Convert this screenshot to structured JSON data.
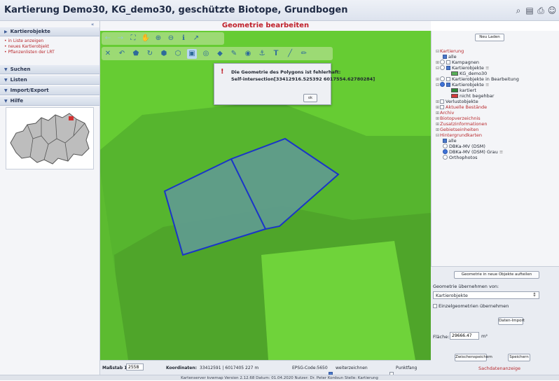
{
  "app": {
    "title": "Kartierung Demo30, KG_demo30, geschützte Biotope, Grundbogen"
  },
  "title_icons": [
    "search-icon",
    "book-icon",
    "print-icon",
    "user-icon"
  ],
  "sidebar": {
    "sections": [
      {
        "label": "Kartierobjekte"
      },
      {
        "label": "Suchen"
      },
      {
        "label": "Listen"
      },
      {
        "label": "Import/Export"
      },
      {
        "label": "Hilfe"
      }
    ],
    "links": [
      {
        "label": "• in Liste anzeigen"
      },
      {
        "label": "• neues Kartierobjekt"
      },
      {
        "label": "• Pflanzenlisten der LRT"
      }
    ],
    "collapse_icon": "double-chevron-left-icon"
  },
  "map": {
    "heading": "Geometrie bearbeiten",
    "colors": {
      "field_light": "#66cc33",
      "field_dark": "#4fa52a",
      "polygon_fill": "#5f9b8f",
      "polygon_stroke": "#1a35c8"
    }
  },
  "dialog": {
    "line1": "Die Geometrie des Polygons ist fehlerhaft:",
    "line2": "Self-intersection[33412916.525392 6017554.62780284]",
    "ok_label": "ok"
  },
  "status": {
    "scale_label": "Maßstab 1:",
    "scale_value": "2558",
    "coords_label": "Koordinaten:",
    "coords_value": "33412591 | 6017405",
    "distance": "227 m",
    "epsg": "EPSG-Code:5650",
    "weiterzeichnen": "weiterzeichnen",
    "punktfang": "Punktfang"
  },
  "footer": {
    "text": "Kartenserver kvwmap Version 2.12.68  Datum: 01.04.2020  Nutzer: Dr. Peter Kordsun  Stelle: Kartierung"
  },
  "rightpanel": {
    "reload_label": "Neu Laden",
    "tree": [
      {
        "label": "Kartierung",
        "red": true
      },
      {
        "label": "alle"
      },
      {
        "label": "Kampagnen"
      },
      {
        "label": "Kartierobjekte"
      },
      {
        "label": "KG_demo30"
      },
      {
        "label": "Kartierobjekte in Bearbeitung"
      },
      {
        "label": "Kartierobjekte"
      },
      {
        "label": "kartiert"
      },
      {
        "label": "nicht begehbar"
      },
      {
        "label": "Verlustobjekte"
      },
      {
        "label": "Aktuelle Bestände",
        "red": true
      },
      {
        "label": "Archiv",
        "red": true
      },
      {
        "label": "Biotopverzeichnis",
        "red": true
      },
      {
        "label": "Zusatzinformationen",
        "red": true
      },
      {
        "label": "Gebietseinheiten",
        "red": true
      },
      {
        "label": "Hintergrundkarten",
        "red": true
      },
      {
        "label": "alle"
      },
      {
        "label": "DBKa-MV (DSM)"
      },
      {
        "label": "DBKa-MV (DSM) Grau"
      },
      {
        "label": "Orthophotos"
      }
    ],
    "split_button": "Geometrie in neue Objekte aufteilen",
    "uebernehmen_label": "Geometrie übernehmen von:",
    "uebernehmen_value": "Kartierobjekte",
    "einzel_label": "Einzelgeometrien übernehmen",
    "datenimport_label": "Daten-Import",
    "flaeche_label": "Fläche:",
    "flaeche_value": "29666.47",
    "flaeche_unit": "m²",
    "zwischenspeichern_label": "Zwischenspeichern",
    "speichern_label": "Speichern",
    "sachdaten_label": "Sachdatenanzeige"
  }
}
